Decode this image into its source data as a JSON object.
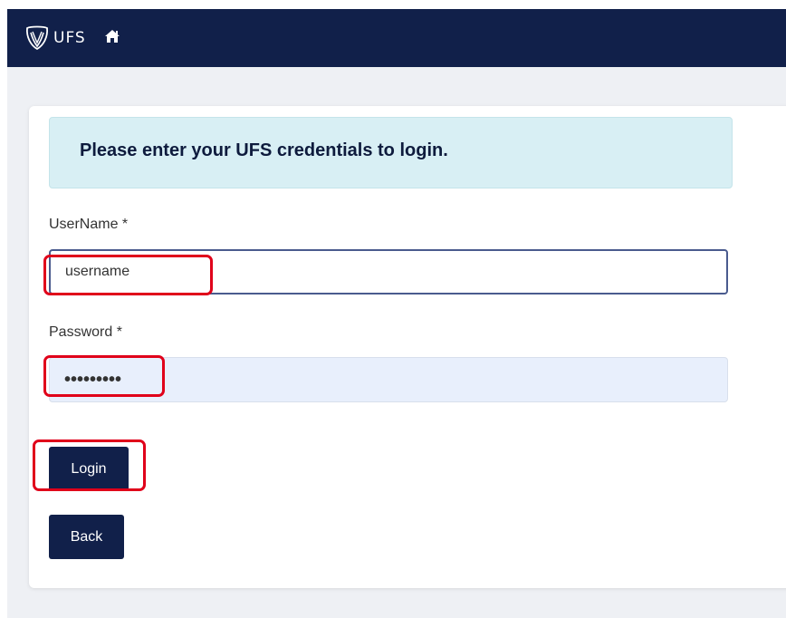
{
  "header": {
    "brand": "UFS",
    "logo_icon": "ufs-shield-icon",
    "home_icon": "home-icon",
    "background": "#11204a"
  },
  "login": {
    "message": "Please enter your UFS credentials to login.",
    "username_label": "UserName *",
    "username_value": "username",
    "password_label": "Password *",
    "password_value": "passwordx",
    "login_label": "Login",
    "back_label": "Back"
  },
  "annotations": {
    "color": "#e0001a",
    "highlighted": [
      "username-input",
      "password-input",
      "login-button"
    ]
  }
}
